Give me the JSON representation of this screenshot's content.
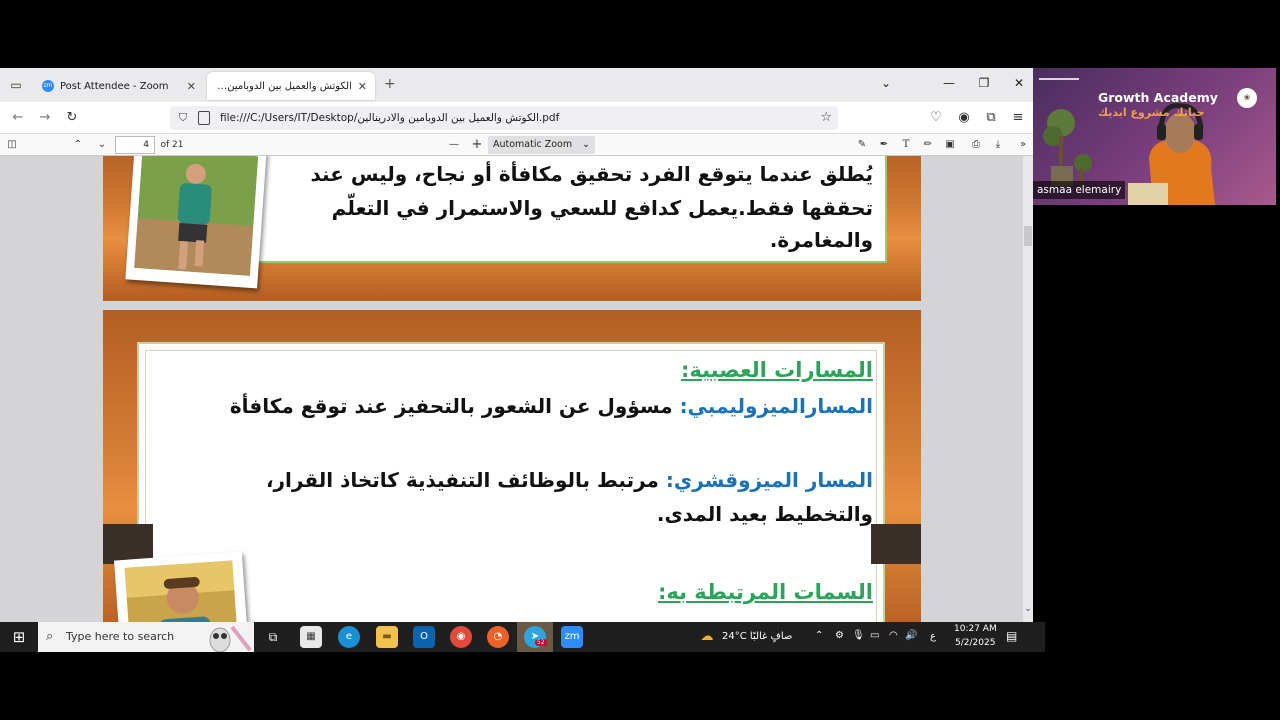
{
  "browser": {
    "tabs": [
      {
        "label": "Post Attendee - Zoom",
        "favicon": "zm"
      },
      {
        "label": "الكوتش والعميل بين الدوبامين والادر"
      }
    ],
    "url": "file:///C:/Users/IT/Desktop/الكوتش والعميل بين الدوبامين والادرينالين.pdf",
    "icons": [
      "tab-list-icon",
      "close-icon",
      "new-tab-icon",
      "chevron-down-icon",
      "minimize-icon",
      "restore-icon",
      "back-icon",
      "forward-icon",
      "reload-icon",
      "shield-icon",
      "star-icon",
      "pocket-icon",
      "account-icon",
      "extensions-icon",
      "menu-icon"
    ]
  },
  "pdf_toolbar": {
    "page_number": "4",
    "page_count": "of 21",
    "zoom": "Automatic Zoom",
    "zoom_out": "—",
    "zoom_in": "+"
  },
  "slide1": {
    "line1": "يُطلق عندما يتوقع الفرد تحقيق مكافأة أو نجاح، وليس عند",
    "line2": "تحققها فقط.يعمل كدافع للسعي والاستمرار في التعلّم والمغامرة."
  },
  "slide2": {
    "heading1": "المسارات العصبية:",
    "path1_label": "المسارالميزوليمبي:",
    "path1_text": " مسؤول عن الشعور بالتحفيز عند توقع مكافأة",
    "path2_label": "المسار الميزوقشري:",
    "path2_text": " مرتبط بالوظائف التنفيذية كاتخاذ القرار،",
    "path2_line2": "والتخطيط بعيد المدى.",
    "heading2": "السمات المرتبطة به:"
  },
  "taskbar": {
    "search_placeholder": "Type here to search",
    "weather": "24°C  صافٍ غالبًا",
    "lang": "ع",
    "time": "10:27 AM",
    "date": "5/2/2025",
    "telegram_badge": "52"
  },
  "zoom_video": {
    "brand": "Growth Academy",
    "brand_sub": "حياتك مشروع ابديك",
    "participant_name": "asmaa elemairy"
  }
}
